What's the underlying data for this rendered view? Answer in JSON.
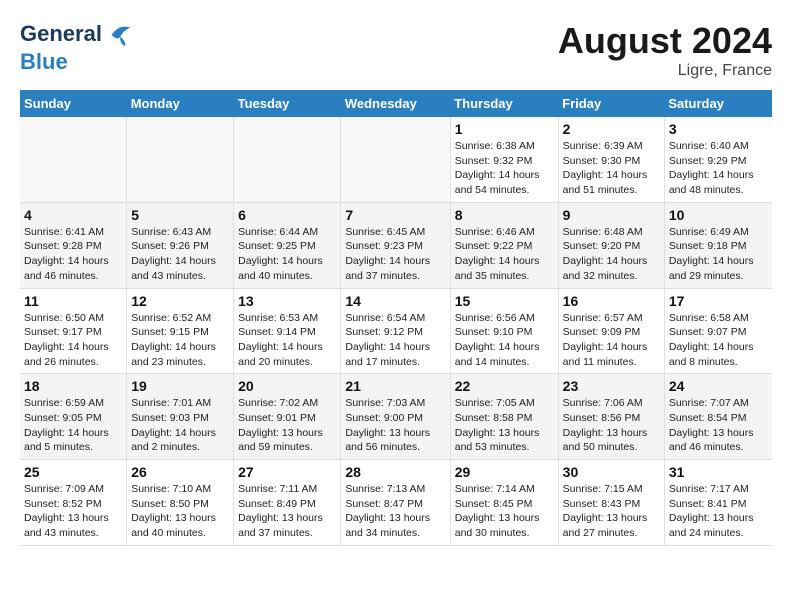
{
  "header": {
    "logo_line1": "General",
    "logo_line2": "Blue",
    "month_title": "August 2024",
    "location": "Ligre, France"
  },
  "days_of_week": [
    "Sunday",
    "Monday",
    "Tuesday",
    "Wednesday",
    "Thursday",
    "Friday",
    "Saturday"
  ],
  "weeks": [
    {
      "row_class": "row-normal",
      "cells": [
        {
          "empty": true
        },
        {
          "empty": true
        },
        {
          "empty": true
        },
        {
          "empty": true
        },
        {
          "day": "1",
          "sunrise": "6:38 AM",
          "sunset": "9:32 PM",
          "daylight": "14 hours and 54 minutes."
        },
        {
          "day": "2",
          "sunrise": "6:39 AM",
          "sunset": "9:30 PM",
          "daylight": "14 hours and 51 minutes."
        },
        {
          "day": "3",
          "sunrise": "6:40 AM",
          "sunset": "9:29 PM",
          "daylight": "14 hours and 48 minutes."
        }
      ]
    },
    {
      "row_class": "row-alt",
      "cells": [
        {
          "day": "4",
          "sunrise": "6:41 AM",
          "sunset": "9:28 PM",
          "daylight": "14 hours and 46 minutes."
        },
        {
          "day": "5",
          "sunrise": "6:43 AM",
          "sunset": "9:26 PM",
          "daylight": "14 hours and 43 minutes."
        },
        {
          "day": "6",
          "sunrise": "6:44 AM",
          "sunset": "9:25 PM",
          "daylight": "14 hours and 40 minutes."
        },
        {
          "day": "7",
          "sunrise": "6:45 AM",
          "sunset": "9:23 PM",
          "daylight": "14 hours and 37 minutes."
        },
        {
          "day": "8",
          "sunrise": "6:46 AM",
          "sunset": "9:22 PM",
          "daylight": "14 hours and 35 minutes."
        },
        {
          "day": "9",
          "sunrise": "6:48 AM",
          "sunset": "9:20 PM",
          "daylight": "14 hours and 32 minutes."
        },
        {
          "day": "10",
          "sunrise": "6:49 AM",
          "sunset": "9:18 PM",
          "daylight": "14 hours and 29 minutes."
        }
      ]
    },
    {
      "row_class": "row-normal",
      "cells": [
        {
          "day": "11",
          "sunrise": "6:50 AM",
          "sunset": "9:17 PM",
          "daylight": "14 hours and 26 minutes."
        },
        {
          "day": "12",
          "sunrise": "6:52 AM",
          "sunset": "9:15 PM",
          "daylight": "14 hours and 23 minutes."
        },
        {
          "day": "13",
          "sunrise": "6:53 AM",
          "sunset": "9:14 PM",
          "daylight": "14 hours and 20 minutes."
        },
        {
          "day": "14",
          "sunrise": "6:54 AM",
          "sunset": "9:12 PM",
          "daylight": "14 hours and 17 minutes."
        },
        {
          "day": "15",
          "sunrise": "6:56 AM",
          "sunset": "9:10 PM",
          "daylight": "14 hours and 14 minutes."
        },
        {
          "day": "16",
          "sunrise": "6:57 AM",
          "sunset": "9:09 PM",
          "daylight": "14 hours and 11 minutes."
        },
        {
          "day": "17",
          "sunrise": "6:58 AM",
          "sunset": "9:07 PM",
          "daylight": "14 hours and 8 minutes."
        }
      ]
    },
    {
      "row_class": "row-alt",
      "cells": [
        {
          "day": "18",
          "sunrise": "6:59 AM",
          "sunset": "9:05 PM",
          "daylight": "14 hours and 5 minutes."
        },
        {
          "day": "19",
          "sunrise": "7:01 AM",
          "sunset": "9:03 PM",
          "daylight": "14 hours and 2 minutes."
        },
        {
          "day": "20",
          "sunrise": "7:02 AM",
          "sunset": "9:01 PM",
          "daylight": "13 hours and 59 minutes."
        },
        {
          "day": "21",
          "sunrise": "7:03 AM",
          "sunset": "9:00 PM",
          "daylight": "13 hours and 56 minutes."
        },
        {
          "day": "22",
          "sunrise": "7:05 AM",
          "sunset": "8:58 PM",
          "daylight": "13 hours and 53 minutes."
        },
        {
          "day": "23",
          "sunrise": "7:06 AM",
          "sunset": "8:56 PM",
          "daylight": "13 hours and 50 minutes."
        },
        {
          "day": "24",
          "sunrise": "7:07 AM",
          "sunset": "8:54 PM",
          "daylight": "13 hours and 46 minutes."
        }
      ]
    },
    {
      "row_class": "row-normal",
      "cells": [
        {
          "day": "25",
          "sunrise": "7:09 AM",
          "sunset": "8:52 PM",
          "daylight": "13 hours and 43 minutes."
        },
        {
          "day": "26",
          "sunrise": "7:10 AM",
          "sunset": "8:50 PM",
          "daylight": "13 hours and 40 minutes."
        },
        {
          "day": "27",
          "sunrise": "7:11 AM",
          "sunset": "8:49 PM",
          "daylight": "13 hours and 37 minutes."
        },
        {
          "day": "28",
          "sunrise": "7:13 AM",
          "sunset": "8:47 PM",
          "daylight": "13 hours and 34 minutes."
        },
        {
          "day": "29",
          "sunrise": "7:14 AM",
          "sunset": "8:45 PM",
          "daylight": "13 hours and 30 minutes."
        },
        {
          "day": "30",
          "sunrise": "7:15 AM",
          "sunset": "8:43 PM",
          "daylight": "13 hours and 27 minutes."
        },
        {
          "day": "31",
          "sunrise": "7:17 AM",
          "sunset": "8:41 PM",
          "daylight": "13 hours and 24 minutes."
        }
      ]
    }
  ]
}
